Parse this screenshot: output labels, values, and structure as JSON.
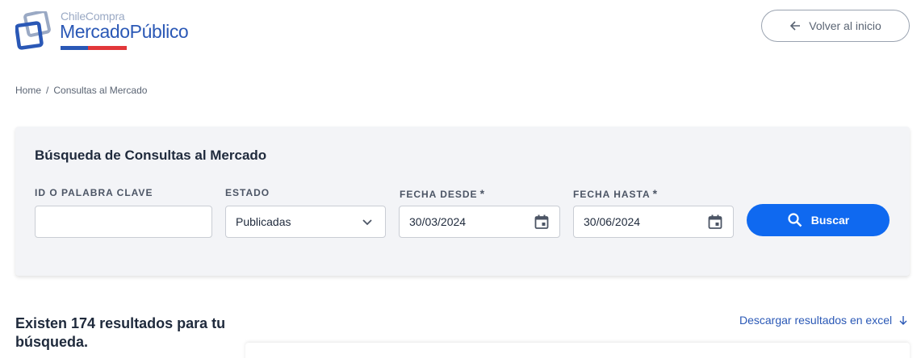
{
  "header": {
    "logo_small": "ChileCompra",
    "logo_big": "MercadoPúblico",
    "back_label": "Volver al inicio"
  },
  "breadcrumb": {
    "home": "Home",
    "separator": "/",
    "current": "Consultas al Mercado"
  },
  "search": {
    "title": "Búsqueda de Consultas al Mercado",
    "id_label": "ID O PALABRA CLAVE",
    "id_value": "",
    "estado_label": "ESTADO",
    "estado_value": "Publicadas",
    "desde_label": "FECHA DESDE",
    "desde_value": "30/03/2024",
    "hasta_label": "FECHA HASTA",
    "hasta_value": "30/06/2024",
    "required_mark": "*",
    "button_label": "Buscar"
  },
  "results": {
    "title": "Existen 174 resultados para tu búsqueda.",
    "excel_label": "Descargar resultados en excel"
  },
  "colors": {
    "primary": "#0f69f0",
    "brand_blue": "#2a58b6",
    "brand_red": "#e2373a",
    "card_bg": "#f3f4f7"
  },
  "icons": [
    "arrow-left-icon",
    "chevron-down-icon",
    "calendar-icon",
    "search-icon",
    "arrow-down-icon"
  ]
}
